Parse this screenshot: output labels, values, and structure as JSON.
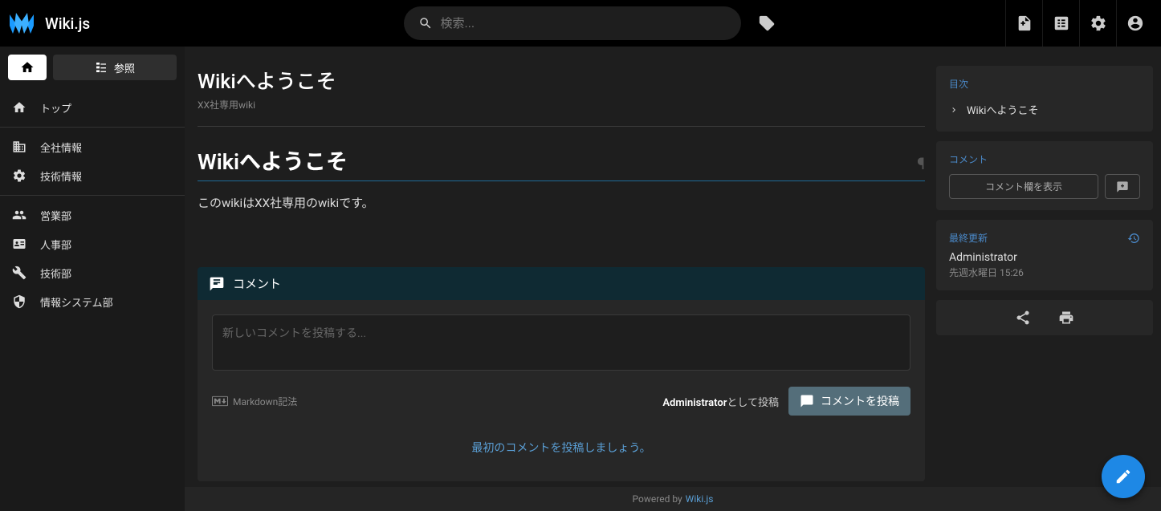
{
  "site": {
    "title": "Wiki.js"
  },
  "search": {
    "placeholder": "検索..."
  },
  "sidebar": {
    "browse_label": "参照",
    "items": [
      {
        "label": "トップ",
        "icon": "home"
      },
      {
        "label": "全社情報",
        "icon": "building"
      },
      {
        "label": "技術情報",
        "icon": "gear"
      },
      {
        "label": "営業部",
        "icon": "people"
      },
      {
        "label": "人事部",
        "icon": "id-card"
      },
      {
        "label": "技術部",
        "icon": "tools"
      },
      {
        "label": "情報システム部",
        "icon": "shield"
      }
    ]
  },
  "page": {
    "title": "Wikiへようこそ",
    "subtitle": "XX社専用wiki",
    "heading1": "Wikiへようこそ",
    "body": "このwikiはXX社専用のwikiです。"
  },
  "comments": {
    "header": "コメント",
    "placeholder": "新しいコメントを投稿する...",
    "markdown_hint": "Markdown記法",
    "post_as_prefix": "Administrator",
    "post_as_suffix": "として投稿",
    "post_button": "コメントを投稿",
    "first_comment_msg": "最初のコメントを投稿しましょう。"
  },
  "toc": {
    "title": "目次",
    "items": [
      {
        "label": "Wikiへようこそ"
      }
    ]
  },
  "sidepanel_comments": {
    "title": "コメント",
    "view_button": "コメント欄を表示"
  },
  "last_updated": {
    "title": "最終更新",
    "user": "Administrator",
    "time": "先週水曜日 15:26"
  },
  "footer": {
    "powered_by": "Powered by",
    "link_text": "Wiki.js"
  }
}
